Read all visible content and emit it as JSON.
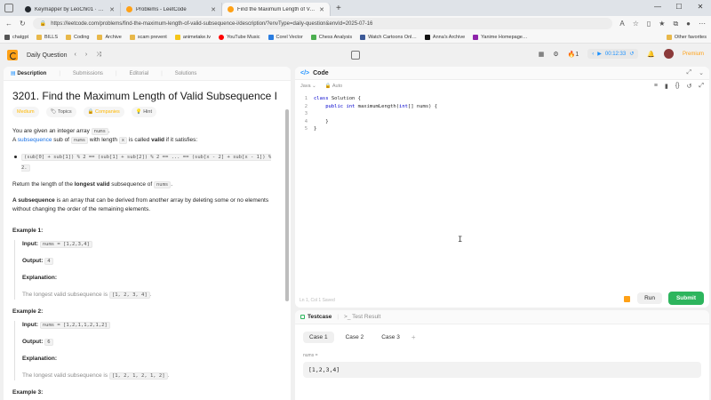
{
  "browser": {
    "tabs": [
      {
        "title": "Keymapper by LeoChi01 · Pull Re…",
        "color": "#24292f",
        "active": false
      },
      {
        "title": "Problems - LeetCode",
        "color": "#ffa116",
        "active": false
      },
      {
        "title": "Find the Maximum Length of Valid",
        "color": "#ffa116",
        "active": true
      }
    ],
    "new_tab": "+",
    "url": "https://leetcode.com/problems/find-the-maximum-length-of-valid-subsequence-i/description/?envType=daily-question&envId=2025-07-16",
    "bookmarks": [
      "chatgpt",
      "BILLS",
      "Coding",
      "Archive",
      "scam prevent",
      "animetake.tv",
      "YouTube Music",
      "Corel Vector",
      "Chess Analysis",
      "Watch Cartoons Onl…",
      "Anna's Archive",
      "Yanime Homepage…"
    ],
    "other_favorites": "Other favorites"
  },
  "nav": {
    "daily_question": "Daily Question",
    "streak": "1",
    "timer": "00:12:33",
    "premium": "Premium"
  },
  "left": {
    "tabs": [
      "Description",
      "Submissions",
      "Editorial",
      "Solutions"
    ],
    "title": "3201. Find the Maximum Length of Valid Subsequence I",
    "badges": {
      "difficulty": "Medium",
      "topics": "Topics",
      "companies": "Companies",
      "hint": "Hint"
    },
    "intro_1a": "You are given an integer array ",
    "intro_1code": "nums",
    "intro_1b": ".",
    "intro_2a": "A ",
    "intro_2link": "subsequence",
    "intro_2b": " sub",
    "intro_2c": " of ",
    "intro_2code": "nums",
    "intro_2d": " with length ",
    "intro_2code2": "x",
    "intro_2e": " is called ",
    "intro_2bold": "valid",
    "intro_2f": " if it satisfies:",
    "bullet_code": "(sub[0] + sub[1]) % 2 == (sub[1] + sub[2]) % 2 == ... == (sub[x - 2] + sub[x - 1]) % 2.",
    "return_a": "Return the length of the ",
    "return_bold": "longest valid",
    "return_b": " subsequence of ",
    "return_code": "nums",
    "return_c": ".",
    "subseq_bold": "A subsequence",
    "subseq_text": " is an array that can be derived from another array by deleting some or no elements without changing the order of the remaining elements.",
    "examples": [
      {
        "title": "Example 1:",
        "input_label": "Input:",
        "input": "nums = [1,2,3,4]",
        "output_label": "Output:",
        "output": "4",
        "expl_label": "Explanation:",
        "expl_text": "The longest valid subsequence is ",
        "expl_code": "[1, 2, 3, 4]",
        "expl_end": "."
      },
      {
        "title": "Example 2:",
        "input_label": "Input:",
        "input": "nums = [1,2,1,1,2,1,2]",
        "output_label": "Output:",
        "output": "6",
        "expl_label": "Explanation:",
        "expl_text": "The longest valid subsequence is ",
        "expl_code": "[1, 2, 1, 2, 1, 2]",
        "expl_end": "."
      }
    ],
    "example3_title": "Example 3:"
  },
  "editor": {
    "title": "Code",
    "language": "Java",
    "auto": "Auto",
    "lines": [
      {
        "n": "1",
        "text": "class Solution {"
      },
      {
        "n": "2",
        "text": "    public int maximumLength(int[] nums) {"
      },
      {
        "n": "3",
        "text": ""
      },
      {
        "n": "4",
        "text": "    }"
      },
      {
        "n": "5",
        "text": "}"
      }
    ],
    "status": "Ln 1, Col 1     Saved",
    "run": "Run",
    "submit": "Submit"
  },
  "testcase": {
    "tab": "Testcase",
    "result_tab": "Test Result",
    "cases": [
      "Case 1",
      "Case 2",
      "Case 3"
    ],
    "add": "+",
    "var_label": "nums =",
    "value": "[1,2,3,4]"
  }
}
